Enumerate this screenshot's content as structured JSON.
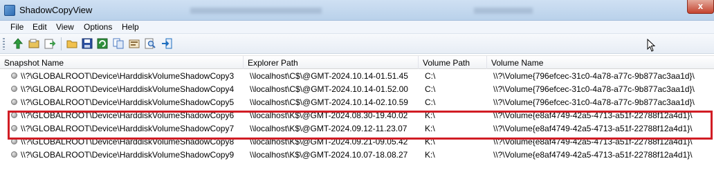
{
  "window": {
    "title": "ShadowCopyView",
    "close_glyph": "x"
  },
  "menu": [
    {
      "label": "File"
    },
    {
      "label": "Edit"
    },
    {
      "label": "View"
    },
    {
      "label": "Options"
    },
    {
      "label": "Help"
    }
  ],
  "toolbar": {
    "buttons": [
      {
        "name": "go-up-icon",
        "color": "#2e9e3e"
      },
      {
        "name": "open-file-icon",
        "color": "#c9a13a"
      },
      {
        "name": "export-icon",
        "color": "#3c9e4a"
      },
      {
        "name": "folder-icon",
        "color": "#e0b040"
      },
      {
        "name": "save-icon",
        "color": "#2b4fa0"
      },
      {
        "name": "refresh-icon",
        "color": "#2f8f3c"
      },
      {
        "name": "copy-icon",
        "color": "#4a78c0"
      },
      {
        "name": "properties-icon",
        "color": "#8a6a3a"
      },
      {
        "name": "find-icon",
        "color": "#3a6fb5"
      },
      {
        "name": "exit-icon",
        "color": "#1f6fbf"
      }
    ]
  },
  "table": {
    "columns": [
      {
        "label": "Snapshot Name"
      },
      {
        "label": "Explorer Path"
      },
      {
        "label": "Volume Path"
      },
      {
        "label": "Volume Name"
      }
    ],
    "sort_indicator": "/",
    "rows": [
      {
        "snapshot": "\\\\?\\GLOBALROOT\\Device\\HarddiskVolumeShadowCopy3",
        "explorer": "\\\\localhost\\C$\\@GMT-2024.10.14-01.51.45",
        "vpath": "C:\\",
        "vname": "\\\\?\\Volume{796efcec-31c0-4a78-a77c-9b877ac3aa1d}\\"
      },
      {
        "snapshot": "\\\\?\\GLOBALROOT\\Device\\HarddiskVolumeShadowCopy4",
        "explorer": "\\\\localhost\\C$\\@GMT-2024.10.14-01.52.00",
        "vpath": "C:\\",
        "vname": "\\\\?\\Volume{796efcec-31c0-4a78-a77c-9b877ac3aa1d}\\"
      },
      {
        "snapshot": "\\\\?\\GLOBALROOT\\Device\\HarddiskVolumeShadowCopy5",
        "explorer": "\\\\localhost\\C$\\@GMT-2024.10.14-02.10.59",
        "vpath": "C:\\",
        "vname": "\\\\?\\Volume{796efcec-31c0-4a78-a77c-9b877ac3aa1d}\\"
      },
      {
        "snapshot": "\\\\?\\GLOBALROOT\\Device\\HarddiskVolumeShadowCopy6",
        "explorer": "\\\\localhost\\K$\\@GMT-2024.08.30-19.40.02",
        "vpath": "K:\\",
        "vname": "\\\\?\\Volume{e8af4749-42a5-4713-a51f-22788f12a4d1}\\"
      },
      {
        "snapshot": "\\\\?\\GLOBALROOT\\Device\\HarddiskVolumeShadowCopy7",
        "explorer": "\\\\localhost\\K$\\@GMT-2024.09.12-11.23.07",
        "vpath": "K:\\",
        "vname": "\\\\?\\Volume{e8af4749-42a5-4713-a51f-22788f12a4d1}\\"
      },
      {
        "snapshot": "\\\\?\\GLOBALROOT\\Device\\HarddiskVolumeShadowCopy8",
        "explorer": "\\\\localhost\\K$\\@GMT-2024.09.21-09.05.42",
        "vpath": "K:\\",
        "vname": "\\\\?\\Volume{e8af4749-42a5-4713-a51f-22788f12a4d1}\\"
      },
      {
        "snapshot": "\\\\?\\GLOBALROOT\\Device\\HarddiskVolumeShadowCopy9",
        "explorer": "\\\\localhost\\K$\\@GMT-2024.10.07-18.08.27",
        "vpath": "K:\\",
        "vname": "\\\\?\\Volume{e8af4749-42a5-4713-a51f-22788f12a4d1}\\"
      }
    ]
  },
  "annotation": {
    "highlight_color": "#d11c24"
  }
}
